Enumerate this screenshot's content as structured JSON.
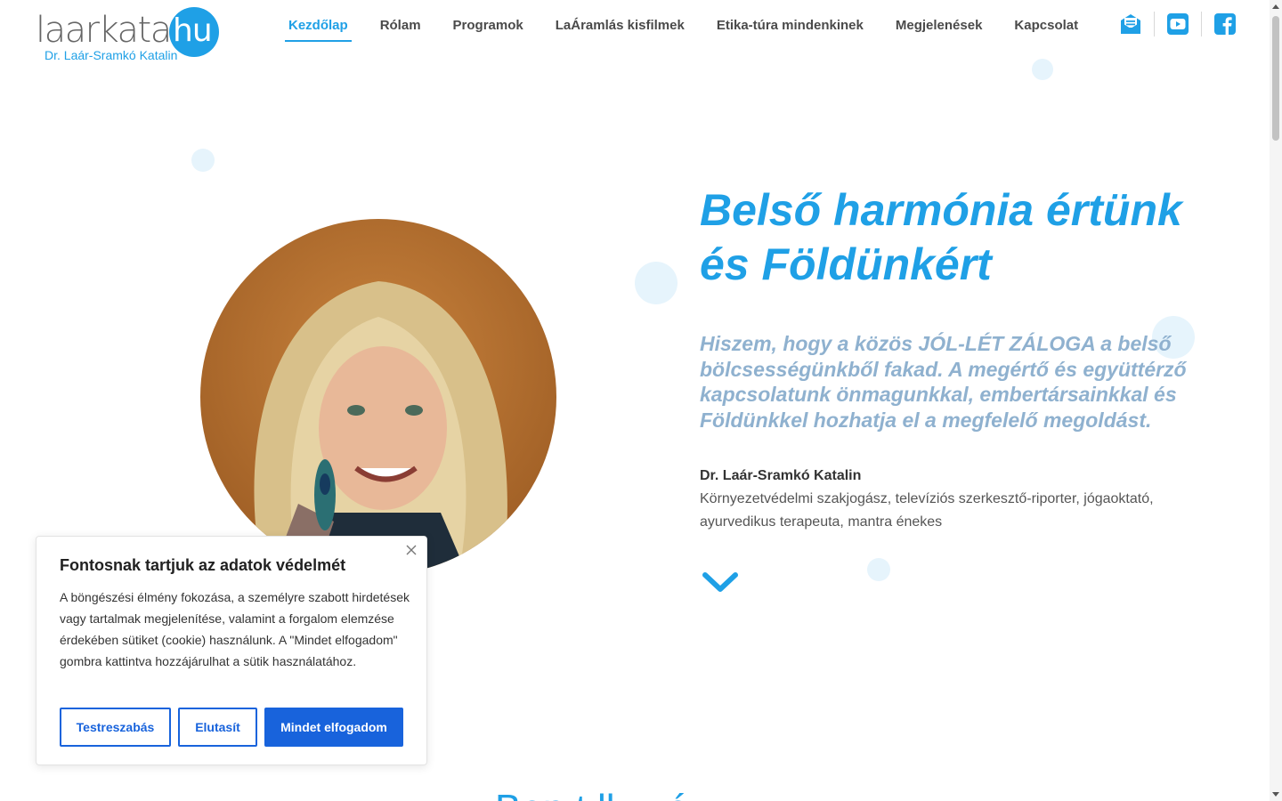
{
  "logo": {
    "word": "laarkata.",
    "tld": "hu",
    "subtitle": "Dr. Laár-Sramkó Katalin"
  },
  "nav": {
    "items": [
      {
        "label": "Kezdőlap",
        "active": true
      },
      {
        "label": "Rólam"
      },
      {
        "label": "Programok"
      },
      {
        "label": "LaÁramlás kisfilmek"
      },
      {
        "label": "Etika-túra mindenkinek"
      },
      {
        "label": "Megjelenések"
      },
      {
        "label": "Kapcsolat"
      }
    ]
  },
  "social": {
    "icons": [
      "newsletter-icon",
      "youtube-icon",
      "facebook-icon"
    ]
  },
  "hero": {
    "title": "Belső harmónia értünk és Földünkért",
    "quote": "Hiszem, hogy a közös JÓL-LÉT ZÁLOGA a belső bölcsességünkből fakad. A megértő és együttérző kapcsolatunk önmagunkkal, embertársainkkal és Földünkkel hozhatja el a megfelelő megoldást.",
    "name": "Dr. Laár-Sramkó Katalin",
    "role": "Környezetvédelmi szakjogász, televíziós szerkesztő-riporter, jógaoktató, ayurvedikus terapeuta, mantra énekes"
  },
  "next_section": {
    "title_peek": "Ben     t  lk  z  é"
  },
  "cookie": {
    "title": "Fontosnak tartjuk az adatok védelmét",
    "text": "A böngészési élmény fokozása, a személyre szabott hirdetések vagy tartalmak megjelenítése, valamint a forgalom elemzése érdekében sütiket (cookie) használunk. A \"Mindet elfogadom\" gombra kattintva hozzájárulhat a sütik használatához.",
    "customize_label": "Testreszabás",
    "reject_label": "Elutasít",
    "accept_label": "Mindet elfogadom"
  },
  "colors": {
    "accent": "#1fa0e6",
    "quote": "#8fb1cf",
    "button": "#1863dc",
    "bubble": "#e6f4fc"
  }
}
